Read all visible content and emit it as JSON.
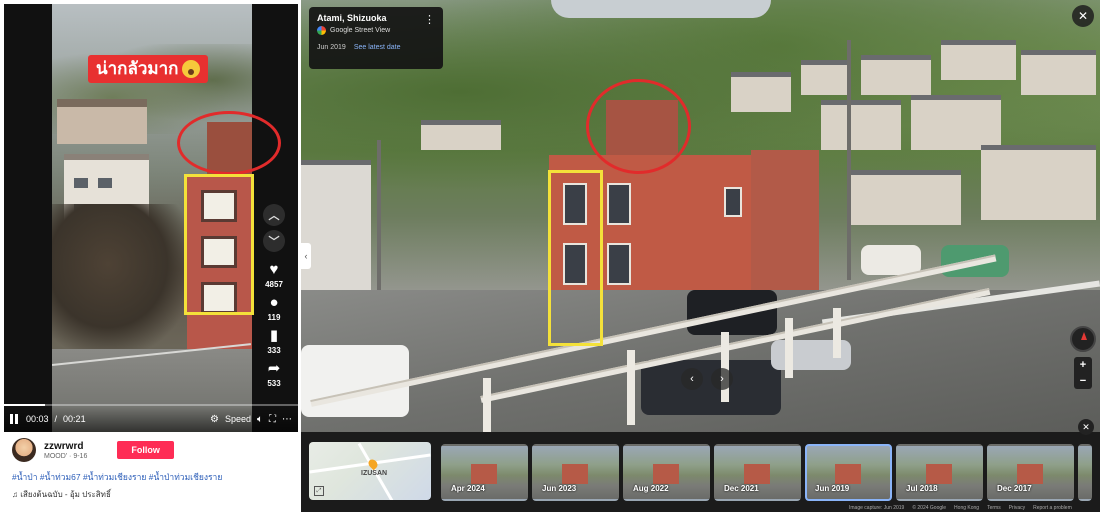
{
  "video": {
    "caption": "น่ากลัวมาก",
    "time_current": "00:03",
    "time_total": "00:21",
    "progress_fraction": 0.14,
    "speed_label": "Speed",
    "likes": "4857",
    "comments": "119",
    "saves": "333",
    "shares": "533"
  },
  "post": {
    "username": "zzwrwrd",
    "subline": "MOOD' · 9-16",
    "follow_label": "Follow",
    "hashtags": "#น้ำป่า #น้ำท่วม67 #น้ำท่วมเชียงราย #น้ำป่าท่วมเชียงราย",
    "music": "♫ เสียงต้นฉบับ - อุ้ม ประสิทธิ์"
  },
  "streetview": {
    "location": "Atami, Shizuoka",
    "source": "Google Street View",
    "date": "Jun 2019",
    "latest_link": "See latest date",
    "map_label": "IZUSAN",
    "thumbnails": [
      {
        "label": "Apr 2024",
        "selected": false
      },
      {
        "label": "Jun 2023",
        "selected": false
      },
      {
        "label": "Aug 2022",
        "selected": false
      },
      {
        "label": "Dec 2021",
        "selected": false
      },
      {
        "label": "Jun 2019",
        "selected": true
      },
      {
        "label": "Jul 2018",
        "selected": false
      },
      {
        "label": "Dec 2017",
        "selected": false
      }
    ],
    "footer": {
      "capture": "Image capture: Jun 2019",
      "copyright": "© 2024 Google",
      "region": "Hong Kong",
      "terms": "Terms",
      "privacy": "Privacy",
      "report": "Report a problem"
    }
  },
  "colors": {
    "highlight_red": "#e12b2b",
    "highlight_yellow": "#f4e13a",
    "follow_pink": "#fe2c55",
    "link_blue": "#8ab4f8"
  }
}
